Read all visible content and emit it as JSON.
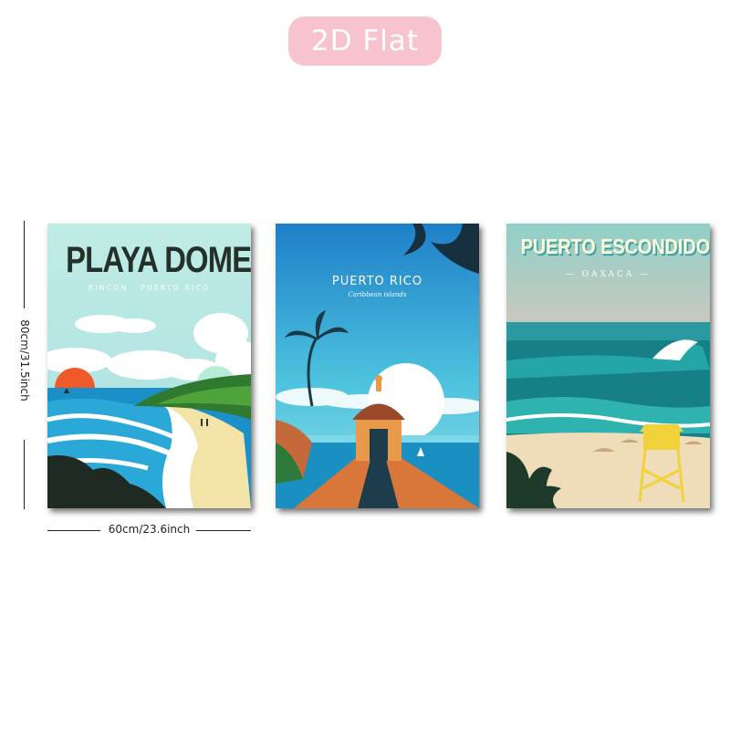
{
  "badge": {
    "label": "2D Flat"
  },
  "posters": [
    {
      "title": "PLAYA DOMES",
      "subtitle": "RINCON · PUERTO RICO"
    },
    {
      "title": "PUERTO RICO",
      "subtitle": "Caribbean islands"
    },
    {
      "title": "PUERTO ESCONDIDO",
      "subtitle": "— OAXACA —"
    }
  ],
  "dimensions": {
    "height_label": "80cm/31.5inch",
    "width_label": "60cm/23.6inch"
  }
}
